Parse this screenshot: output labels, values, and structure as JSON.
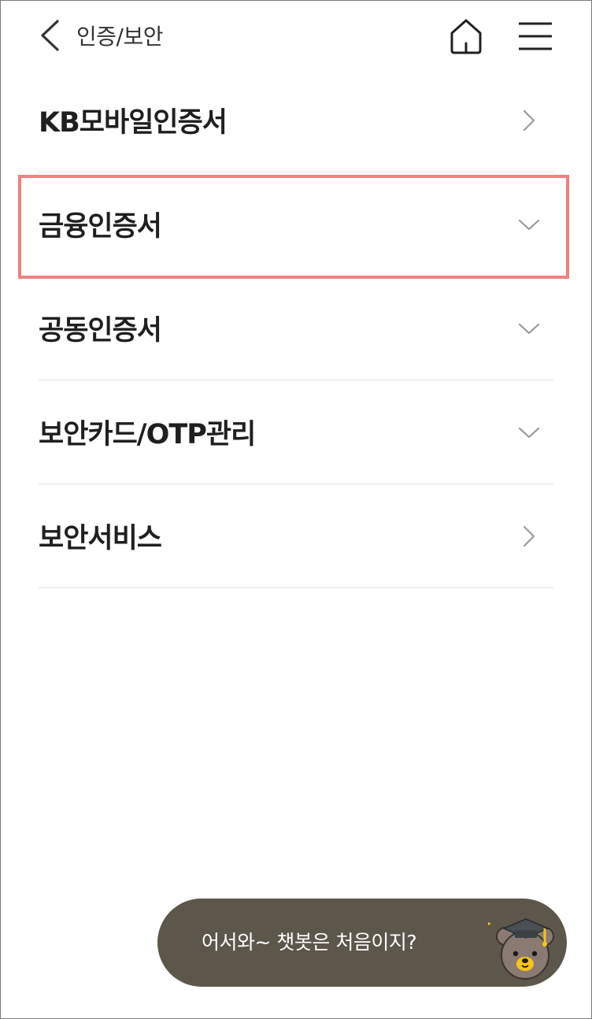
{
  "header": {
    "title": "인증/보안",
    "back_icon": "chevron-left-icon",
    "home_icon": "home-icon",
    "menu_icon": "hamburger-menu-icon"
  },
  "menu": {
    "items": [
      {
        "label": "KB모바일인증서",
        "indicator": "chevron-right-icon"
      },
      {
        "label": "금융인증서",
        "indicator": "chevron-down-icon",
        "highlighted": true
      },
      {
        "label": "공동인증서",
        "indicator": "chevron-down-icon"
      },
      {
        "label": "보안카드/OTP관리",
        "indicator": "chevron-down-icon"
      },
      {
        "label": "보안서비스",
        "indicator": "chevron-right-icon"
      }
    ]
  },
  "chatbot": {
    "message": "어서와~ 챗봇은 처음이지?",
    "icon": "bear-mascot-icon"
  },
  "colors": {
    "highlight": "#f08080",
    "chatbot_bg": "#5d564b",
    "divider": "#e3e3e3"
  }
}
